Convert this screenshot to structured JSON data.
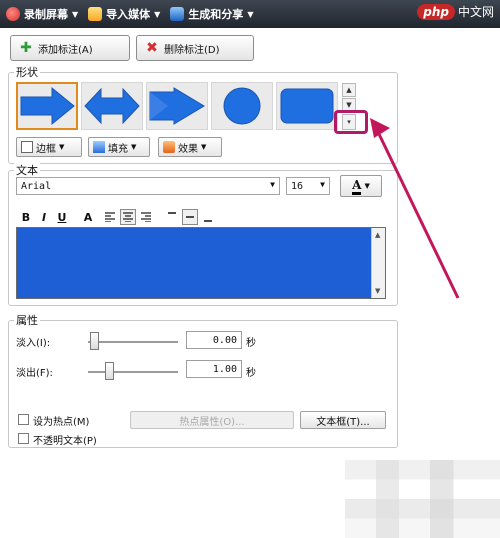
{
  "toolbar": {
    "record_label": "录制屏幕",
    "import_label": "导入媒体",
    "share_label": "生成和分享"
  },
  "watermark": {
    "php": "php",
    "cn": "中文网"
  },
  "buttons": {
    "add_label": "添加标注(A)",
    "delete_label": "删除标注(D)"
  },
  "shape_group": {
    "legend": "形状",
    "shapes": [
      "right-arrow",
      "double-arrow",
      "chevron-arrow",
      "circle",
      "rounded-rectangle"
    ],
    "selected_index": 0,
    "border_label": "边框",
    "fill_label": "填充",
    "effect_label": "效果"
  },
  "text_group": {
    "legend": "文本",
    "font_value": "Arial",
    "size_value": "16",
    "color_label": "A",
    "format": {
      "bold": "B",
      "italic": "I",
      "underline": "U",
      "font_color": "A",
      "align_left": "left-align-icon",
      "align_center": "center-align-icon",
      "align_right": "right-align-icon",
      "valign_top": "top-align-icon",
      "valign_middle": "middle-align-icon",
      "valign_bottom": "bottom-align-icon"
    },
    "fill_color": "#1f5fd6"
  },
  "props_group": {
    "legend": "属性",
    "fade_in_label": "淡入(I):",
    "fade_in_value": "0.00",
    "fade_in_unit": "秒",
    "fade_out_label": "淡出(F):",
    "fade_out_value": "1.00",
    "fade_out_unit": "秒",
    "hotspot_label": "设为热点(M)",
    "hotspot_props_label": "热点属性(O)...",
    "textbox_label": "文本框(T)...",
    "opaque_text_label": "不透明文本(P)"
  },
  "colors": {
    "shape_blue": "#1f6fe0",
    "selection_orange": "#e08a1e",
    "highlight_magenta": "#b01a68"
  }
}
